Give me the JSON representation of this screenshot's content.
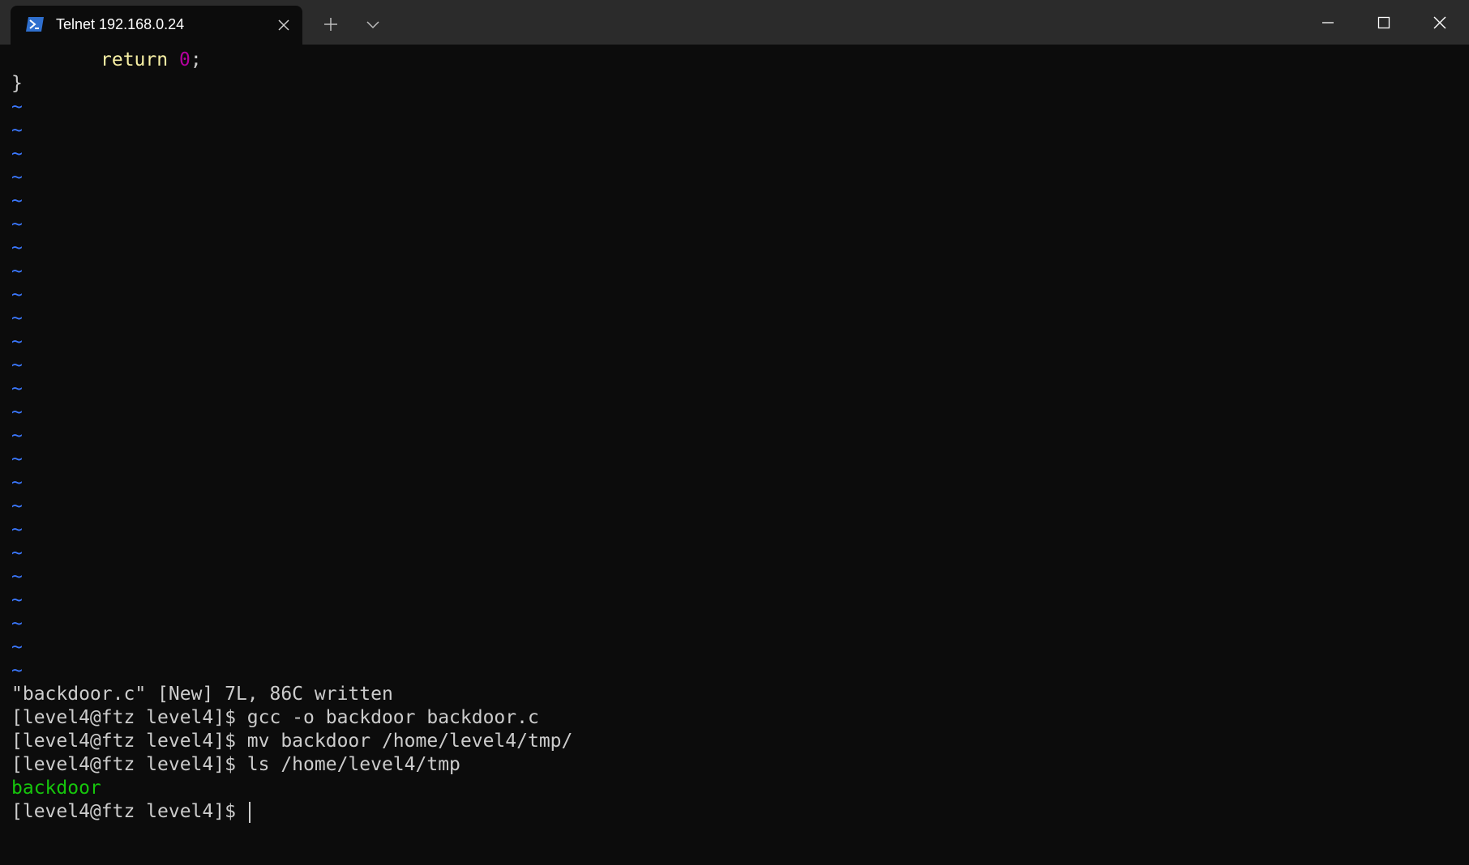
{
  "tab": {
    "title": "Telnet 192.168.0.24",
    "icon": "powershell-icon",
    "close_icon": "close-icon"
  },
  "toolbar": {
    "new_tab_icon": "plus-icon",
    "dropdown_icon": "chevron-down-icon"
  },
  "window_controls": {
    "minimize_icon": "minimize-icon",
    "maximize_icon": "maximize-icon",
    "close_icon": "close-icon"
  },
  "editor": {
    "code_return_keyword": "return",
    "code_return_value": "0",
    "code_semicolon": ";",
    "code_closing_brace": "}",
    "tilde_char": "~",
    "tilde_count": 25,
    "status_message": "\"backdoor.c\" [New] 7L, 86C written"
  },
  "shell": {
    "lines": [
      "[level4@ftz level4]$ gcc -o backdoor backdoor.c",
      "[level4@ftz level4]$ mv backdoor /home/level4/tmp/",
      "[level4@ftz level4]$ ls /home/level4/tmp"
    ],
    "ls_output": "backdoor",
    "current_prompt": "[level4@ftz level4]$ "
  },
  "colors": {
    "background": "#0c0c0c",
    "titlebar": "#2b2b2b",
    "text": "#cccccc",
    "keyword": "#f9f1a5",
    "number": "#b4009e",
    "tilde": "#3b78ff",
    "directory": "#16c60c"
  }
}
